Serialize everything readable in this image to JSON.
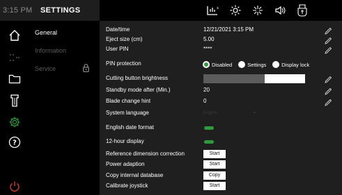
{
  "statusbar": {
    "time": "3:15 PM",
    "title": "SETTINGS",
    "icons": [
      "scale-icon",
      "sun-icon",
      "brightness-icon",
      "speaker-icon",
      "usb-icon"
    ]
  },
  "rail": {
    "icons": [
      "home-icon",
      "dots-icon",
      "folder-icon",
      "blade-icon",
      "gear-icon",
      "help-icon",
      "power-icon"
    ]
  },
  "categories": [
    {
      "label": "General",
      "state": "active"
    },
    {
      "label": "Information",
      "state": "dim"
    },
    {
      "label": "Service",
      "state": "dim"
    }
  ],
  "settings": {
    "datetime": {
      "label": "Date/time",
      "value": "12/21/2021 3:15 PM"
    },
    "eject": {
      "label": "Eject size (cm)",
      "value": "5.00"
    },
    "pin": {
      "label": "User PIN",
      "value": "****"
    },
    "pin_protection": {
      "label": "PIN protection",
      "options": [
        "Disabled",
        "Settings",
        "Display lock"
      ],
      "selected": "Disabled"
    },
    "cutting_brightness": {
      "label": "Cutting button brightness",
      "fraction": 0.6
    },
    "standby": {
      "label": "Standby mode after (Min.)",
      "value": "20"
    },
    "blade_hint": {
      "label": "Blade change hint",
      "value": "0"
    },
    "language": {
      "label": "System language",
      "value": "English"
    },
    "english_date": {
      "label": "English date format",
      "enabled": true
    },
    "hour12": {
      "label": "12-hour display",
      "enabled": true
    },
    "ref_dim": {
      "label": "Reference dimension correction",
      "button": "Start"
    },
    "power_adapt": {
      "label": "Power adaption",
      "button": "Start"
    },
    "copy_db": {
      "label": "Copy internal database",
      "button": "Copy"
    },
    "joystick": {
      "label": "Calibrate joystick",
      "button": "Start"
    }
  },
  "colors": {
    "accent": "#2f9a3c",
    "panel": "#1f1f1f",
    "power": "#d23a2a"
  }
}
